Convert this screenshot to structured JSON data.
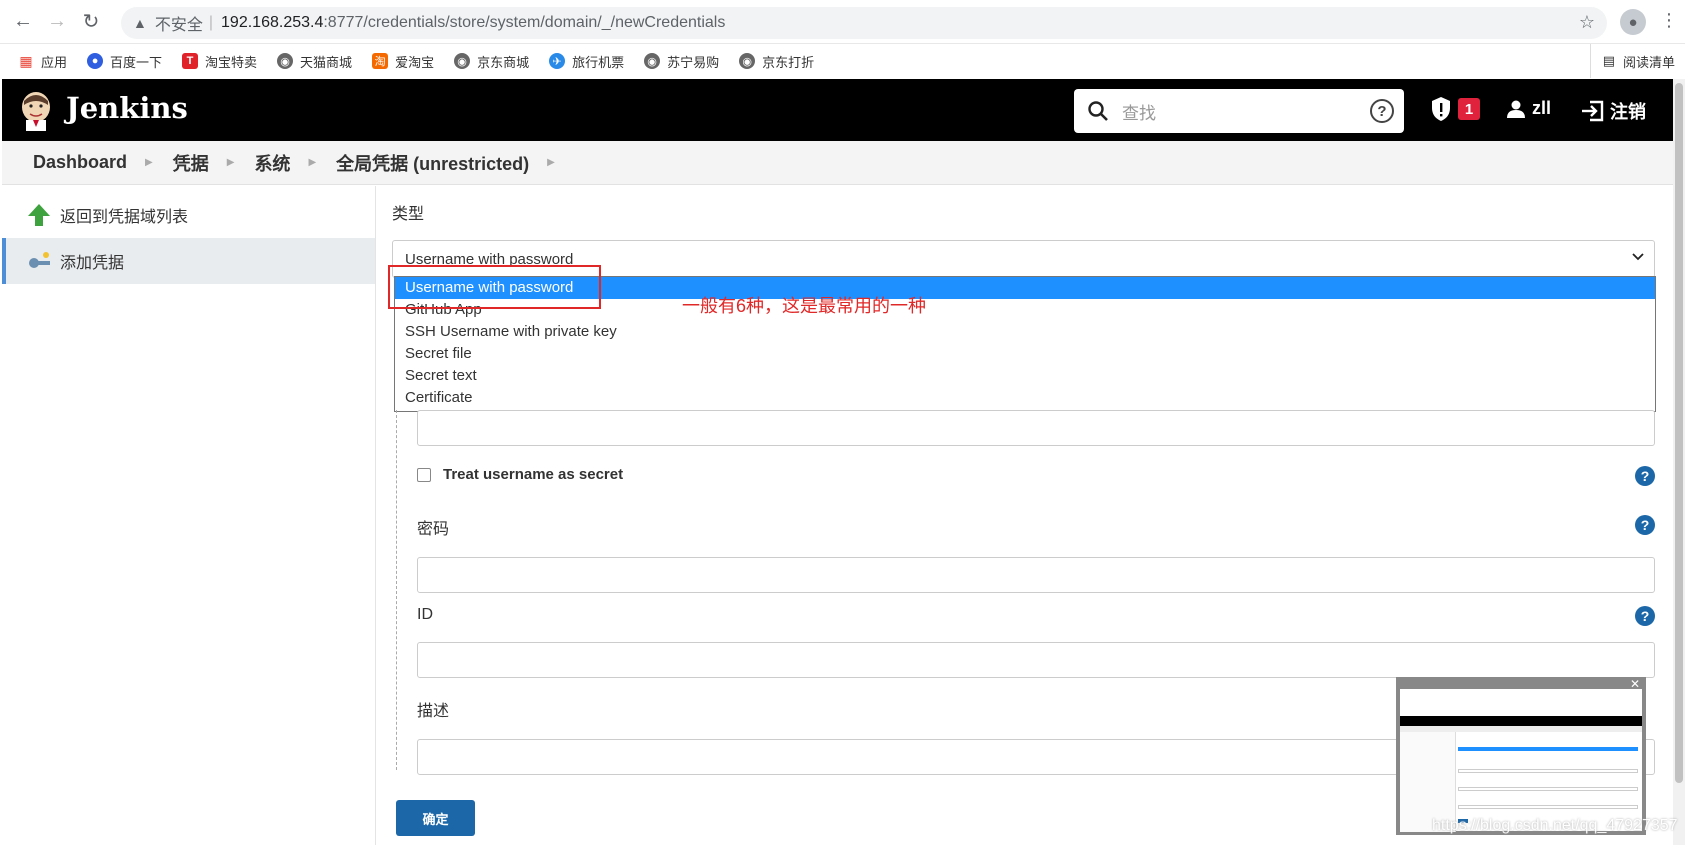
{
  "browser": {
    "insecure_label": "不安全",
    "separator": "|",
    "url_host": "192.168.253.4",
    "url_path": ":8777/credentials/store/system/domain/_/newCredentials",
    "bookmarks": [
      "应用",
      "百度一下",
      "淘宝特卖",
      "天猫商城",
      "爱淘宝",
      "京东商城",
      "旅行机票",
      "苏宁易购",
      "京东打折"
    ],
    "reading_list": "阅读清单"
  },
  "header": {
    "brand": "Jenkins",
    "search_placeholder": "查找",
    "alert_count": "1",
    "user": "zll",
    "logout": "注销"
  },
  "breadcrumb": [
    "Dashboard",
    "凭据",
    "系统",
    "全局凭据 (unrestricted)"
  ],
  "sidebar": {
    "items": [
      {
        "label": "返回到凭据域列表"
      },
      {
        "label": "添加凭据"
      }
    ]
  },
  "form": {
    "type_label": "类型",
    "type_value": "Username with password",
    "options": [
      "Username with password",
      "GitHub App",
      "SSH Username with private key",
      "Secret file",
      "Secret text",
      "Certificate"
    ],
    "annotation": "一般有6种，这是最常用的一种",
    "treat_username_secret": "Treat username as secret",
    "password_label": "密码",
    "id_label": "ID",
    "description_label": "描述",
    "ok_button": "确定"
  },
  "watermark": "https://blog.csdn.net/qq_47927357",
  "colors": {
    "header_bg": "#000000",
    "accent": "#1c67a8",
    "selected_option": "#1e90ff",
    "annotation_red": "#e02828",
    "alert_badge": "#e0223d"
  }
}
